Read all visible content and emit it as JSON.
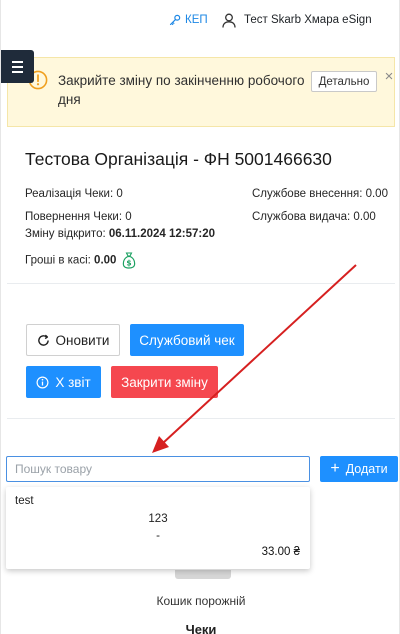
{
  "header": {
    "kep_label": "КЕП",
    "user_label": "Тест Skarb Хмара eSign"
  },
  "alert": {
    "text": "Закрийте зміну по закінченню робочого дня",
    "detail_button": "Детально",
    "close": "×"
  },
  "org": {
    "title": "Тестова Організація - ФН 5001466630",
    "sales_checks": "Реалізація Чеки: 0",
    "return_checks": "Повернення Чеки: 0",
    "shift_opened_label": "Зміну відкрито:",
    "shift_opened_value": "06.11.2024 12:57:20",
    "cash_label": "Гроші в касі:",
    "cash_value": "0.00",
    "service_deposit": "Службове внесення: 0.00",
    "service_withdrawal": "Службова видача: 0.00"
  },
  "actions": {
    "refresh": "Оновити",
    "service_check": "Службовий чек",
    "x_report": "Х звіт",
    "close_shift": "Закрити зміну"
  },
  "search": {
    "placeholder": "Пошук товару",
    "value": "",
    "add_button": "Додати"
  },
  "suggestion": {
    "name": "test",
    "code": "123",
    "extra": "-",
    "price": "33.00 ₴"
  },
  "cart": {
    "empty_text": "Кошик порожній",
    "checks_title": "Чеки"
  },
  "colors": {
    "primary": "#1e90ff",
    "danger": "#f5474f",
    "warning_bg": "#fff8dc",
    "menu_bg": "#1f2b3a",
    "annotation_arrow": "#d62020"
  }
}
